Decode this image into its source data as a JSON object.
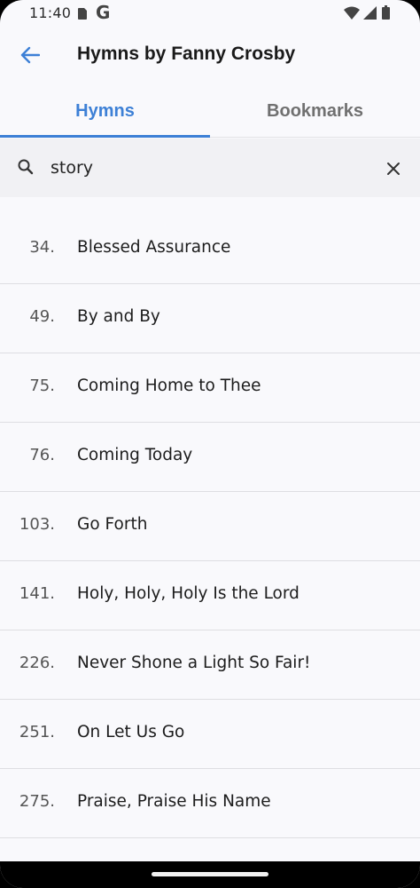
{
  "status_bar": {
    "time": "11:40",
    "icons": [
      "sim-card-icon",
      "google-icon",
      "wifi-icon",
      "signal-icon",
      "battery-icon"
    ],
    "google_letter": "G"
  },
  "header": {
    "title": "Hymns by Fanny Crosby",
    "back_icon": "arrow-left-icon"
  },
  "tabs": [
    {
      "label": "Hymns",
      "selected": true
    },
    {
      "label": "Bookmarks",
      "selected": false
    }
  ],
  "search": {
    "value": "story",
    "search_icon": "search-icon",
    "clear_icon": "close-icon"
  },
  "hymns": [
    {
      "number": "34.",
      "title": "Blessed Assurance"
    },
    {
      "number": "49.",
      "title": "By and By"
    },
    {
      "number": "75.",
      "title": "Coming Home to Thee"
    },
    {
      "number": "76.",
      "title": "Coming Today"
    },
    {
      "number": "103.",
      "title": "Go Forth"
    },
    {
      "number": "141.",
      "title": "Holy, Holy, Holy Is the Lord"
    },
    {
      "number": "226.",
      "title": "Never Shone a Light So Fair!"
    },
    {
      "number": "251.",
      "title": "On Let Us Go"
    },
    {
      "number": "275.",
      "title": "Praise, Praise His Name"
    }
  ],
  "colors": {
    "accent": "#3d80d6",
    "background": "#f9f9fc",
    "search_background": "#f1f1f4"
  }
}
